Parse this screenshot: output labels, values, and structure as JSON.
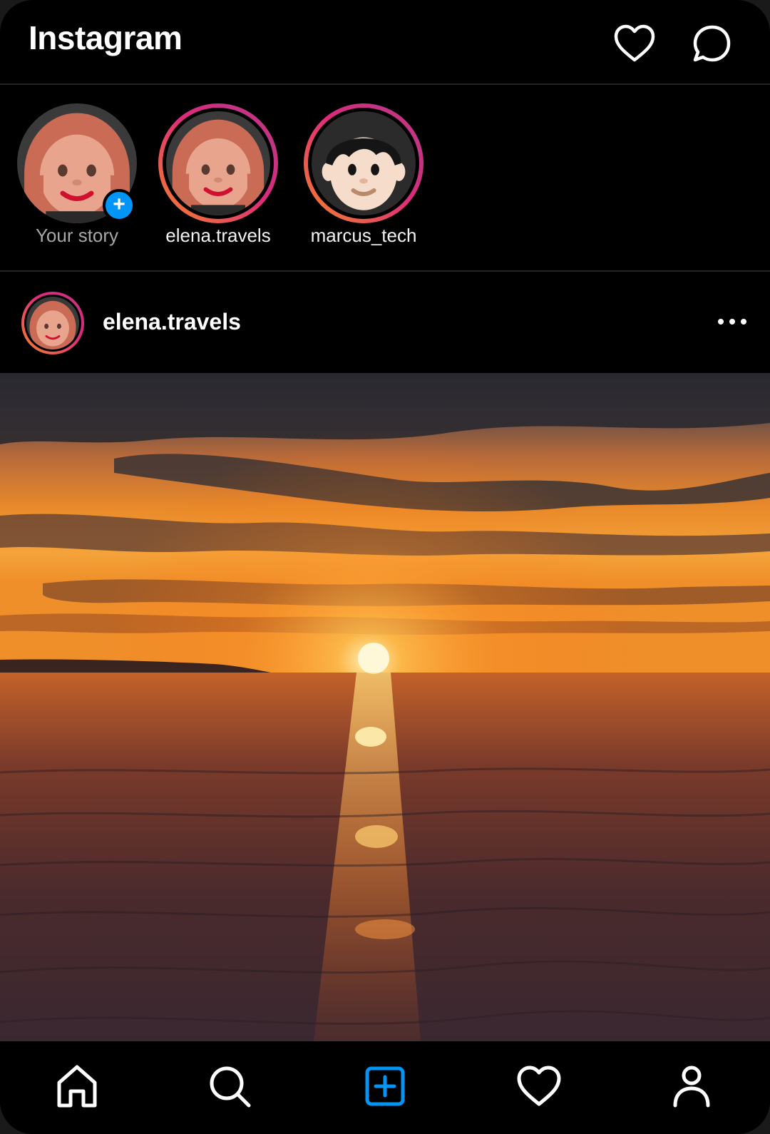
{
  "header": {
    "title": "Instagram",
    "notifications_icon": "heart-icon",
    "messages_icon": "message-bubble-icon"
  },
  "stories": [
    {
      "label": "Your story",
      "avatar": "woman-red-hair-emoji",
      "has_ring": false,
      "badge_icon": "plus-icon",
      "badge": "+"
    },
    {
      "label": "elena.travels",
      "avatar": "woman-red-hair-emoji",
      "has_ring": true
    },
    {
      "label": "marcus_tech",
      "avatar": "man-black-hair-emoji",
      "has_ring": true
    }
  ],
  "post": {
    "username": "elena.travels",
    "avatar": "woman-red-hair-emoji",
    "more_icon": "more-horizontal-icon",
    "image": "sunset-over-sea-photo"
  },
  "bottom_nav": [
    {
      "name": "home",
      "icon": "home-icon",
      "active": true
    },
    {
      "name": "search",
      "icon": "search-icon",
      "active": false
    },
    {
      "name": "create",
      "icon": "add-post-icon",
      "active": false,
      "color": "#0095f6"
    },
    {
      "name": "activity",
      "icon": "heart-icon",
      "active": false
    },
    {
      "name": "profile",
      "icon": "person-icon",
      "active": false
    }
  ],
  "colors": {
    "background": "#000000",
    "divider": "#262626",
    "accent": "#0095f6",
    "story_ring_start": "#f58529",
    "story_ring_end": "#dd2a7b"
  }
}
